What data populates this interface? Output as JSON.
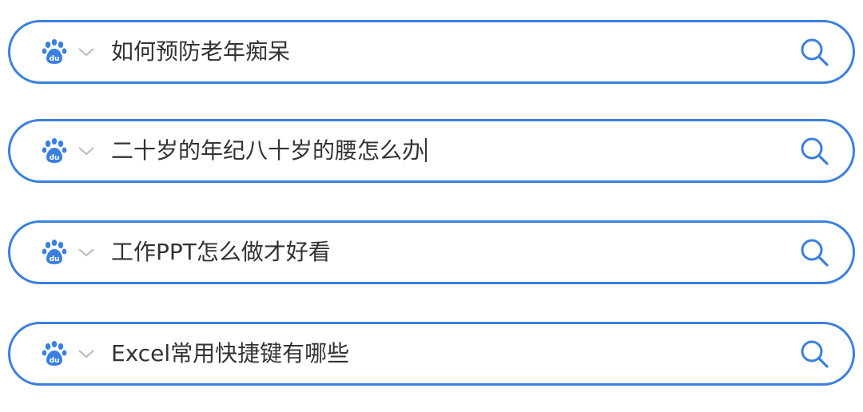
{
  "colors": {
    "accent": "#3a7fe0",
    "text": "#333333",
    "icon_gray": "#bbbbbb"
  },
  "search_bars": [
    {
      "engine_icon": "baidu-paw-icon",
      "engine_badge": "du",
      "dropdown_icon": "chevron-down-icon",
      "query": "如何预防老年痴呆",
      "search_icon": "search-icon"
    },
    {
      "engine_icon": "baidu-paw-icon",
      "engine_badge": "du",
      "dropdown_icon": "chevron-down-icon",
      "query": "二十岁的年纪八十岁的腰怎么办",
      "focused": true,
      "search_icon": "search-icon"
    },
    {
      "engine_icon": "baidu-paw-icon",
      "engine_badge": "du",
      "dropdown_icon": "chevron-down-icon",
      "query": "工作PPT怎么做才好看",
      "search_icon": "search-icon"
    },
    {
      "engine_icon": "baidu-paw-icon",
      "engine_badge": "du",
      "dropdown_icon": "chevron-down-icon",
      "query": "Excel常用快捷键有哪些",
      "search_icon": "search-icon"
    }
  ]
}
